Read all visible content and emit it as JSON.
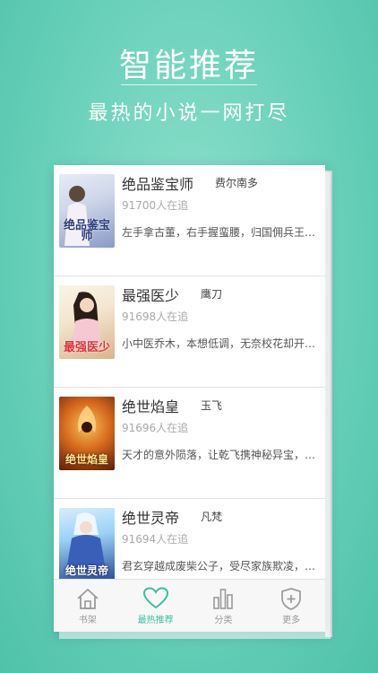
{
  "hero": {
    "title": "智能推荐",
    "subtitle": "最热的小说一网打尽"
  },
  "books": [
    {
      "title": "绝品鉴宝师",
      "author": "费尔南多",
      "followers": "91700人在追",
      "description": "左手拿古董，右手握蛮腰，归国佣兵王…",
      "cover_text": "绝品鉴宝师",
      "cover_colors": [
        "#cfd7ea",
        "#8b9ac6"
      ]
    },
    {
      "title": "最强医少",
      "author": "鹰刀",
      "followers": "91698人在追",
      "description": "小中医乔木，本想低调，无奈校花却开…",
      "cover_text": "最强医少",
      "cover_colors": [
        "#f4e7d2",
        "#d9b48e"
      ]
    },
    {
      "title": "绝世焰皇",
      "author": "玉飞",
      "followers": "91696人在追",
      "description": "天才的意外陨落，让乾飞携神秘异宝，…",
      "cover_text": "绝世焰皇",
      "cover_colors": [
        "#f0a13a",
        "#5a1d08"
      ]
    },
    {
      "title": "绝世灵帝",
      "author": "凡梵",
      "followers": "91694人在追",
      "description": "君玄穿越成废柴公子，受尽家族欺凌，…",
      "cover_text": "绝世灵帝",
      "cover_colors": [
        "#9ad1f5",
        "#2a4a98"
      ]
    }
  ],
  "tabs": [
    {
      "label": "书架",
      "icon": "home-icon",
      "active": false
    },
    {
      "label": "最热推荐",
      "icon": "heart-icon",
      "active": true
    },
    {
      "label": "分类",
      "icon": "bar-chart-icon",
      "active": false
    },
    {
      "label": "更多",
      "icon": "shield-plus-icon",
      "active": false
    }
  ],
  "colors": {
    "accent": "#3dbfa0",
    "background": "#6fd3bd"
  }
}
